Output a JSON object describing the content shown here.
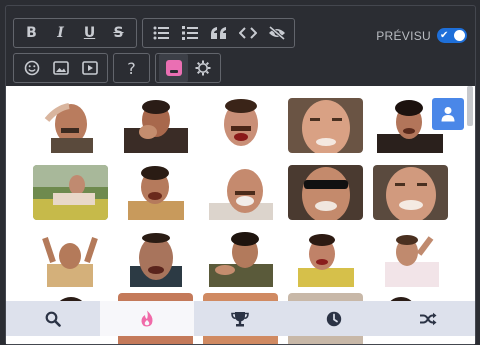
{
  "toolbar": {
    "bold": "B",
    "italic": "I",
    "underline": "U",
    "strike": "S",
    "help": "?"
  },
  "preview": {
    "label": "PRÉVISU",
    "enabled": true
  },
  "stickers": [
    {
      "id": "s1"
    },
    {
      "id": "s2"
    },
    {
      "id": "s3"
    },
    {
      "id": "s4"
    },
    {
      "id": "s5"
    },
    {
      "id": "s6"
    },
    {
      "id": "s7"
    },
    {
      "id": "s8"
    },
    {
      "id": "s9"
    },
    {
      "id": "s10"
    },
    {
      "id": "s11"
    },
    {
      "id": "s12"
    },
    {
      "id": "s13"
    },
    {
      "id": "s14"
    },
    {
      "id": "s15"
    }
  ],
  "tabs": [
    {
      "icon": "search-icon",
      "active": false
    },
    {
      "icon": "fire-icon",
      "active": true
    },
    {
      "icon": "trophy-icon",
      "active": false
    },
    {
      "icon": "clock-icon",
      "active": false
    },
    {
      "icon": "shuffle-icon",
      "active": false
    }
  ],
  "colors": {
    "accent": "#1e6fd9",
    "pink": "#ea6fb3",
    "user_button": "#4a87e8"
  }
}
